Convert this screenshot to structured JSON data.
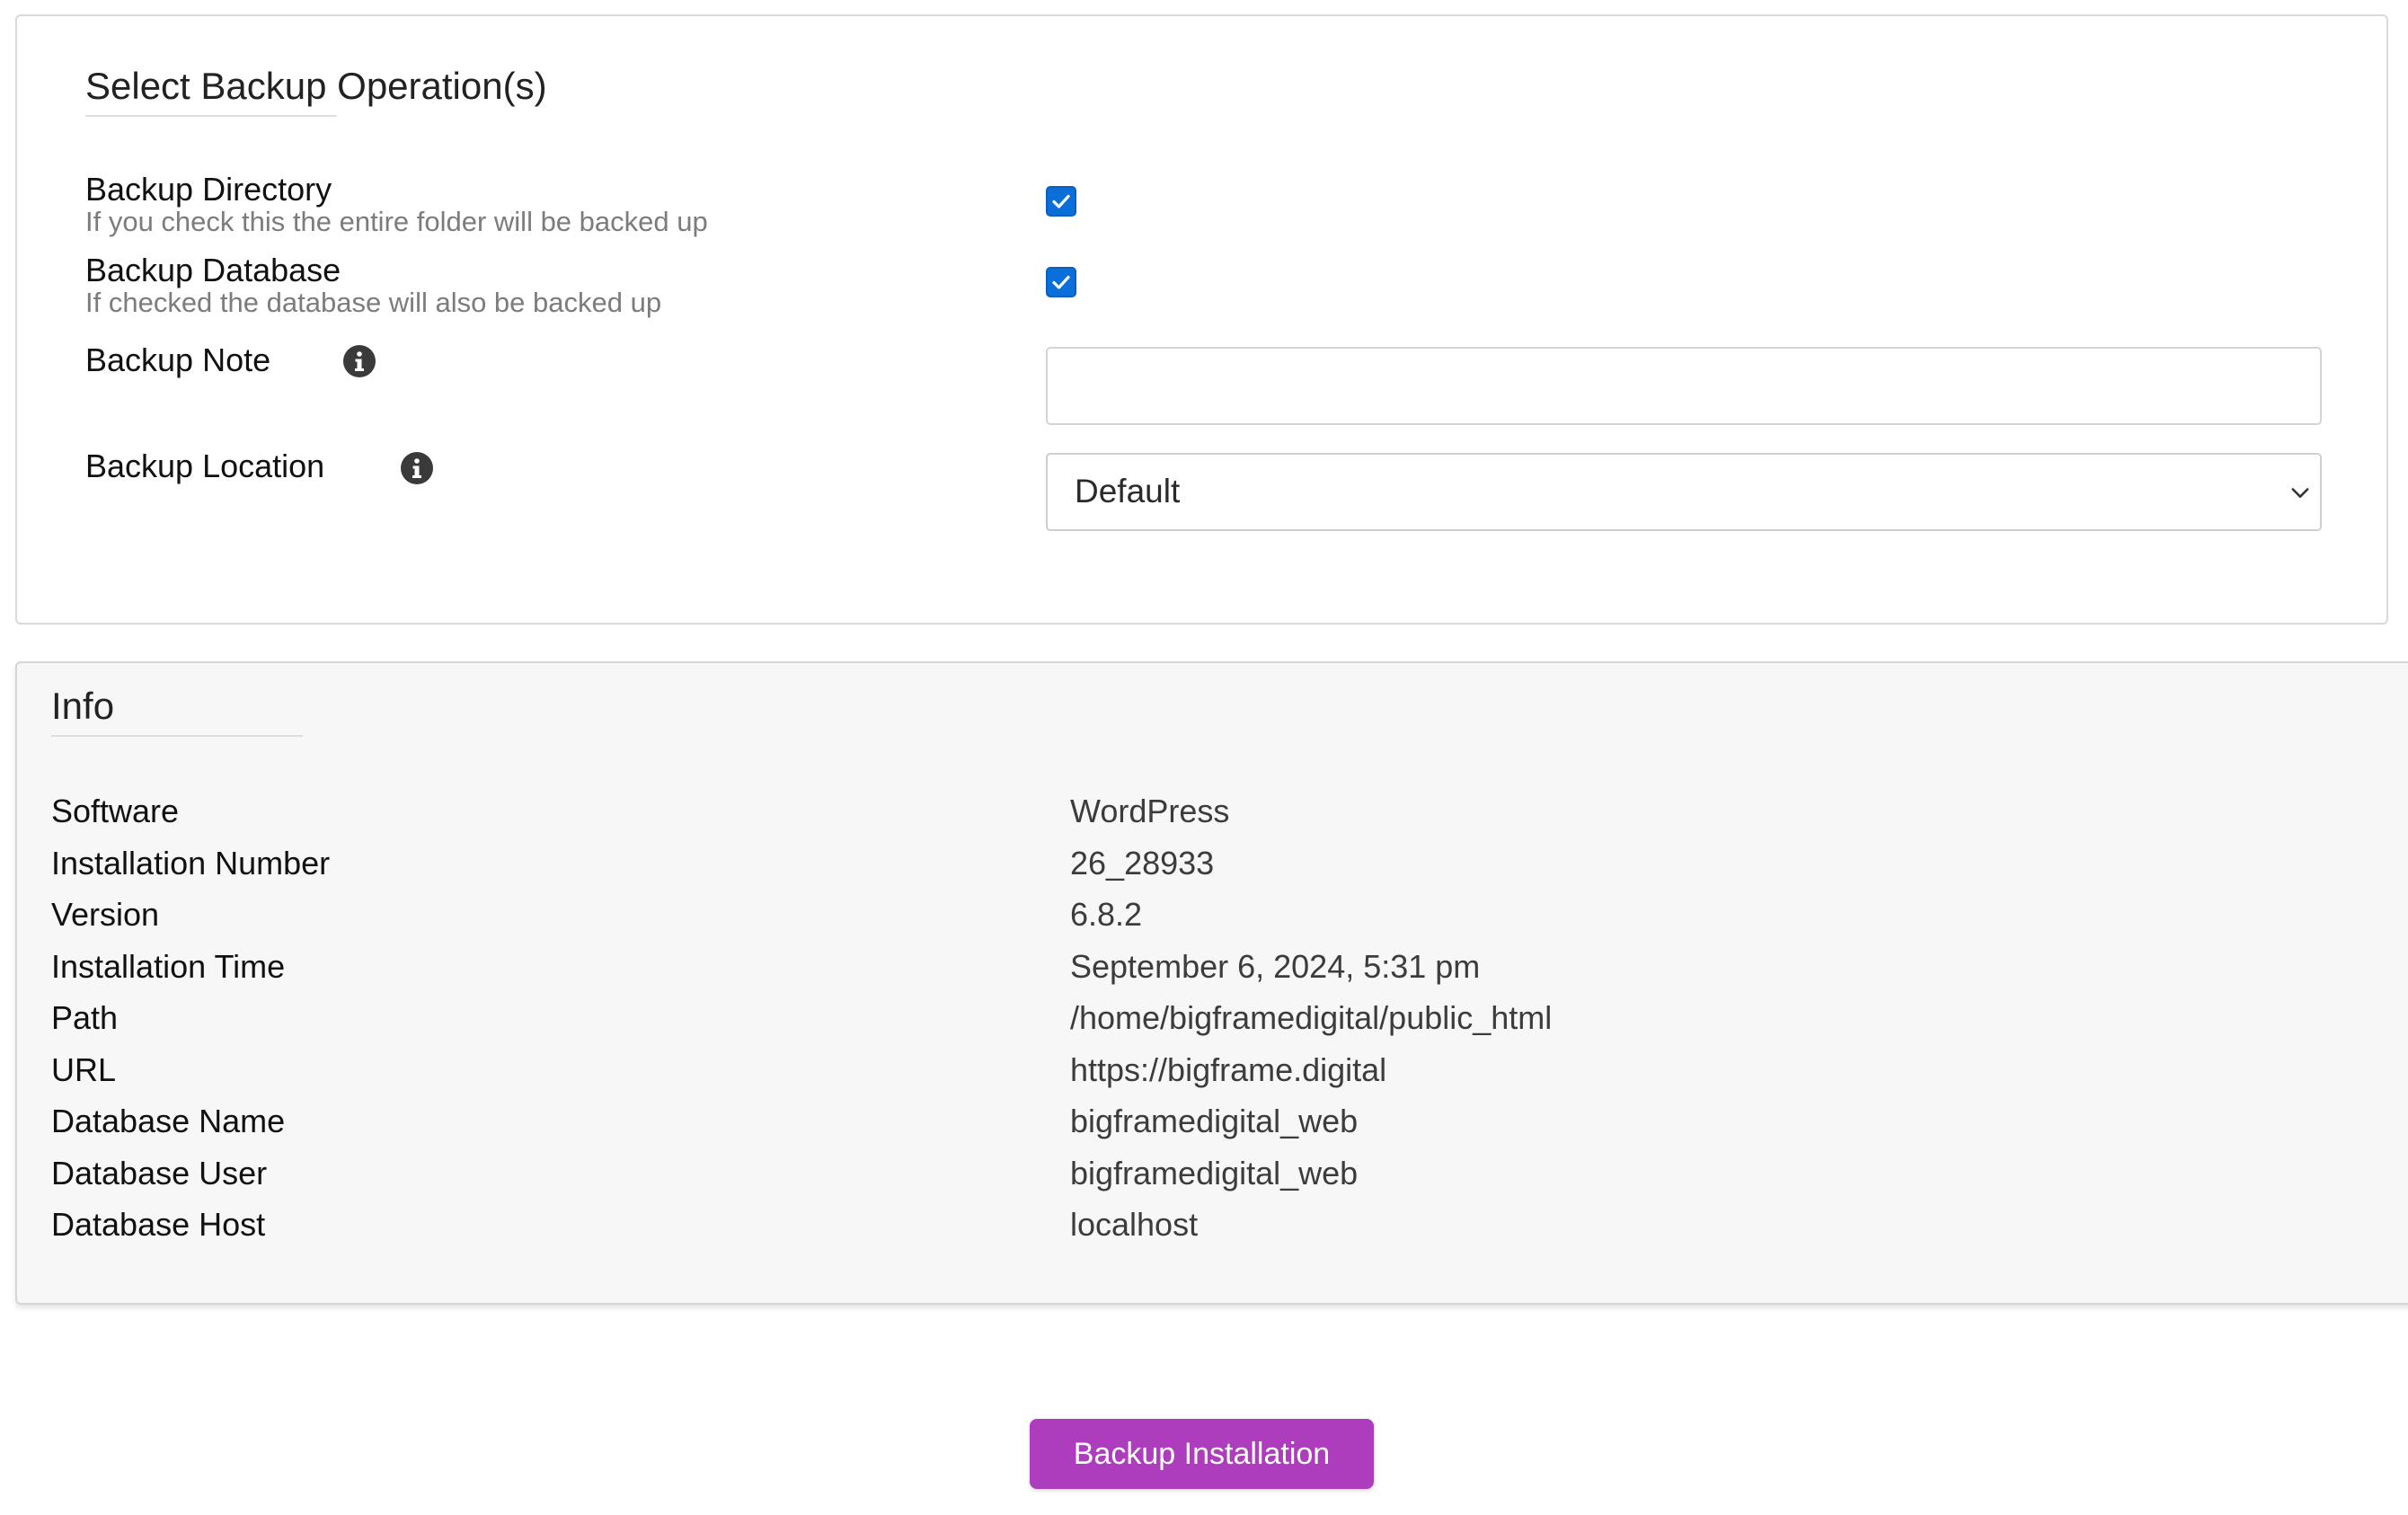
{
  "backup_ops": {
    "title": "Select Backup Operation(s)",
    "directory": {
      "label": "Backup Directory",
      "description": "If you check this the entire folder will be backed up",
      "checked": true
    },
    "database": {
      "label": "Backup Database",
      "description": "If checked the database will also be backed up",
      "checked": true
    },
    "note": {
      "label": "Backup Note",
      "value": "",
      "placeholder": ""
    },
    "location": {
      "label": "Backup Location",
      "selected": "Default"
    }
  },
  "info": {
    "title": "Info",
    "rows": [
      {
        "key": "Software",
        "value": "WordPress"
      },
      {
        "key": "Installation Number",
        "value": "26_28933"
      },
      {
        "key": "Version",
        "value": "6.8.2"
      },
      {
        "key": "Installation Time",
        "value": "September 6, 2024, 5:31 pm"
      },
      {
        "key": "Path",
        "value": "/home/bigframedigital/public_html"
      },
      {
        "key": "URL",
        "value": "https://bigframe.digital"
      },
      {
        "key": "Database Name",
        "value": "bigframedigital_web"
      },
      {
        "key": "Database User",
        "value": "bigframedigital_web"
      },
      {
        "key": "Database Host",
        "value": "localhost"
      }
    ]
  },
  "actions": {
    "backup_label": "Backup Installation"
  },
  "colors": {
    "checkbox_accent": "#0a6fd8",
    "button_primary": "#ad3dbd",
    "info_panel_bg": "#f7f7f7"
  },
  "icons": {
    "checkbox_mark": "check-icon",
    "help": "info-icon",
    "select_arrow": "chevron-down-icon"
  }
}
